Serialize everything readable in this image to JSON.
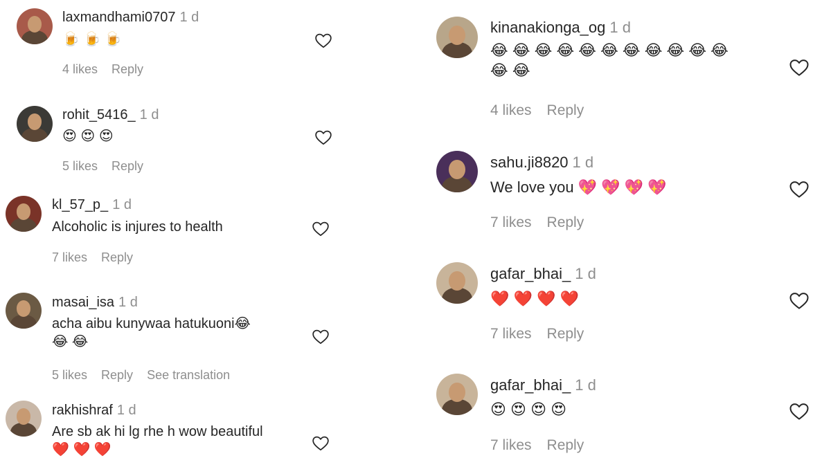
{
  "left": [
    {
      "username": "laxmandhami0707",
      "time": "1 d",
      "lines": [
        "🍺 🍺 🍺"
      ],
      "likes": "4 likes",
      "reply": "Reply",
      "avatar_color": "#a85a4a"
    },
    {
      "username": "rohit_5416_",
      "time": "1 d",
      "lines": [
        "😍 😍 😍"
      ],
      "likes": "5 likes",
      "reply": "Reply",
      "avatar_color": "#3b3a36"
    },
    {
      "username": "kl_57_p_",
      "time": "1 d",
      "lines": [
        "Alcoholic is injures to health"
      ],
      "likes": "7 likes",
      "reply": "Reply",
      "avatar_color": "#7a3328"
    },
    {
      "username": "masai_isa",
      "time": "1 d",
      "lines": [
        "acha aibu kunywaa hatukuoni😂",
        "😂 😂"
      ],
      "likes": "5 likes",
      "reply": "Reply",
      "translation": "See translation",
      "avatar_color": "#6b5a44"
    },
    {
      "username": "rakhishraf",
      "time": "1 d",
      "lines": [
        "Are sb ak hi lg rhe h wow beautiful",
        "❤️ ❤️ ❤️"
      ],
      "avatar_color": "#c9b8a8"
    }
  ],
  "right": [
    {
      "username": "kinanakionga_og",
      "time": "1 d",
      "lines": [
        "😂 😂 😂 😂 😂 😂 😂 😂 😂 😂 😂",
        "😂 😂"
      ],
      "likes": "4 likes",
      "reply": "Reply",
      "avatar_color": "#b8a68a"
    },
    {
      "username": "sahu.ji8820",
      "time": "1 d",
      "lines": [
        "We love you 💖 💖 💖 💖"
      ],
      "likes": "7 likes",
      "reply": "Reply",
      "avatar_color": "#4a2f5a"
    },
    {
      "username": "gafar_bhai_",
      "time": "1 d",
      "lines": [
        "❤️ ❤️ ❤️ ❤️"
      ],
      "likes": "7 likes",
      "reply": "Reply",
      "avatar_color": "#c8b49a"
    },
    {
      "username": "gafar_bhai_",
      "time": "1 d",
      "lines": [
        "😍 😍 😍 😍"
      ],
      "likes": "7 likes",
      "reply": "Reply",
      "avatar_color": "#c8b49a"
    }
  ],
  "colors": {
    "text": "#262626",
    "muted": "#8e8e8e",
    "heart_outline": "#262626"
  },
  "icons": {
    "like": "heart-outline-icon"
  }
}
